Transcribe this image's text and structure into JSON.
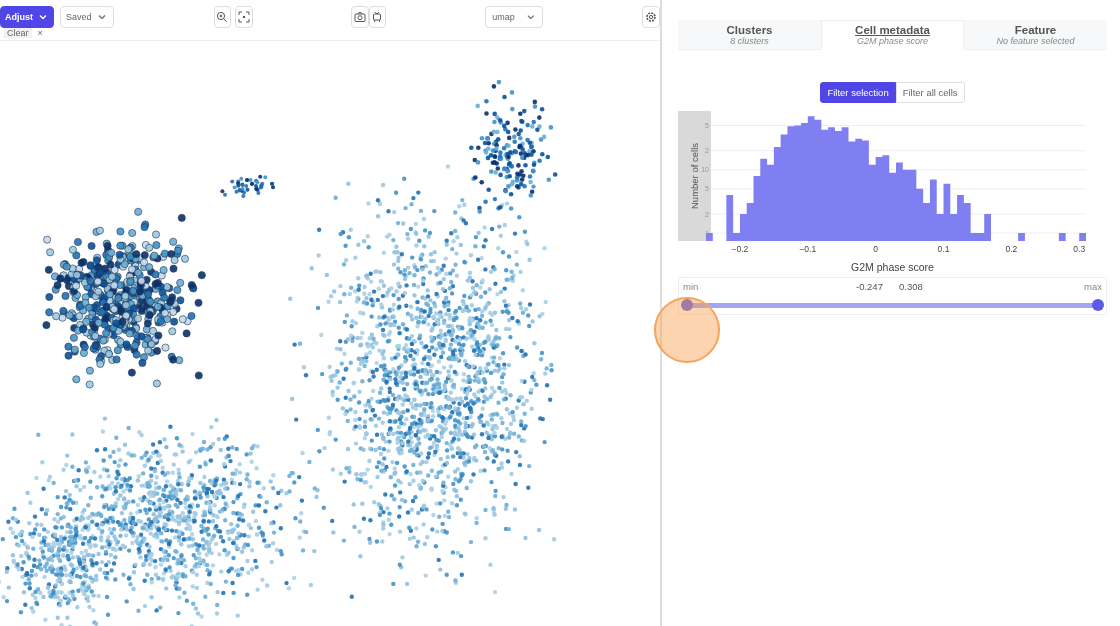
{
  "toolbar": {
    "adjust_button": "Adjust",
    "saved_dropdown": "Saved",
    "clear_chip": {
      "label": "Clear",
      "close": "×"
    },
    "embedding_dropdown": "umap"
  },
  "tabs": [
    {
      "label": "Clusters",
      "subtitle": "8 clusters",
      "selected": false
    },
    {
      "label": "Cell metadata",
      "subtitle": "G2M phase score",
      "selected": true
    },
    {
      "label": "Feature",
      "subtitle": "No feature selected",
      "selected": false
    }
  ],
  "filter_toggle": [
    {
      "label": "Filter selection",
      "selected": true
    },
    {
      "label": "Filter all cells",
      "selected": false
    }
  ],
  "histogram": {
    "y_axis_title": "Number of cells",
    "x_axis_title": "G2M phase score",
    "x_tick_labels": [
      "−0.2",
      "−0.1",
      "0",
      "0.1",
      "0.2",
      "0.3"
    ],
    "y_tick_labels": [
      "5",
      "2",
      "10",
      "5",
      "2",
      "1"
    ]
  },
  "range_slider": {
    "min_label": "min",
    "max_label": "max",
    "low_value": "-0.247",
    "high_value": "0.308",
    "thumbs": [
      {
        "level": 0
      },
      {
        "level": 1
      }
    ]
  }
}
